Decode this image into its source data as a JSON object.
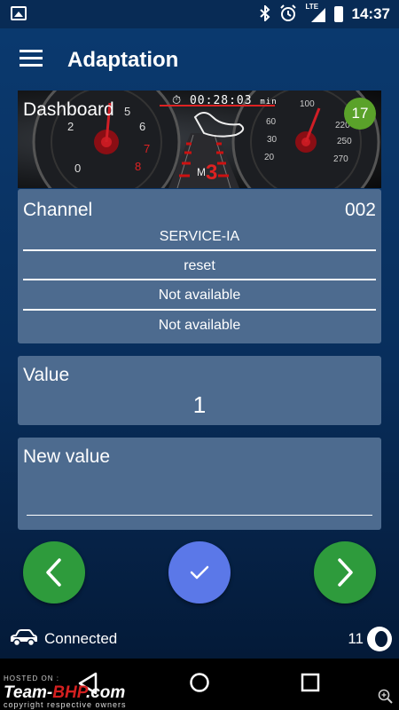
{
  "status_bar": {
    "network": "LTE",
    "time": "14:37",
    "icons": [
      "image-icon",
      "bluetooth-icon",
      "alarm-icon",
      "signal-icon",
      "battery-icon"
    ]
  },
  "toolbar": {
    "title": "Adaptation",
    "menu_icon": "hamburger-menu-icon"
  },
  "dashboard": {
    "label": "Dashboard",
    "badge": "17",
    "timer": "00:28:03",
    "timer_unit": "min"
  },
  "channel": {
    "label": "Channel",
    "number": "002",
    "rows": [
      "SERVICE-IA",
      "reset",
      "Not available",
      "Not available"
    ]
  },
  "value": {
    "label": "Value",
    "current": "1"
  },
  "new_value": {
    "label": "New value",
    "input_value": "",
    "placeholder": ""
  },
  "actions": {
    "prev_icon": "chevron-left-icon",
    "confirm_icon": "checkmark-icon",
    "next_icon": "chevron-right-icon"
  },
  "connection": {
    "status": "Connected",
    "count": "11",
    "car_icon": "car-icon"
  },
  "watermark": {
    "hosted": "HOSTED ON :",
    "brand_a": "Team-",
    "brand_b": "BHP",
    "brand_c": ".com",
    "copyright": "copyright respective owners"
  },
  "colors": {
    "card": "#4d6b8f",
    "green": "#2e9b3c",
    "blue": "#5b78e8",
    "badge": "#5aa22a"
  }
}
